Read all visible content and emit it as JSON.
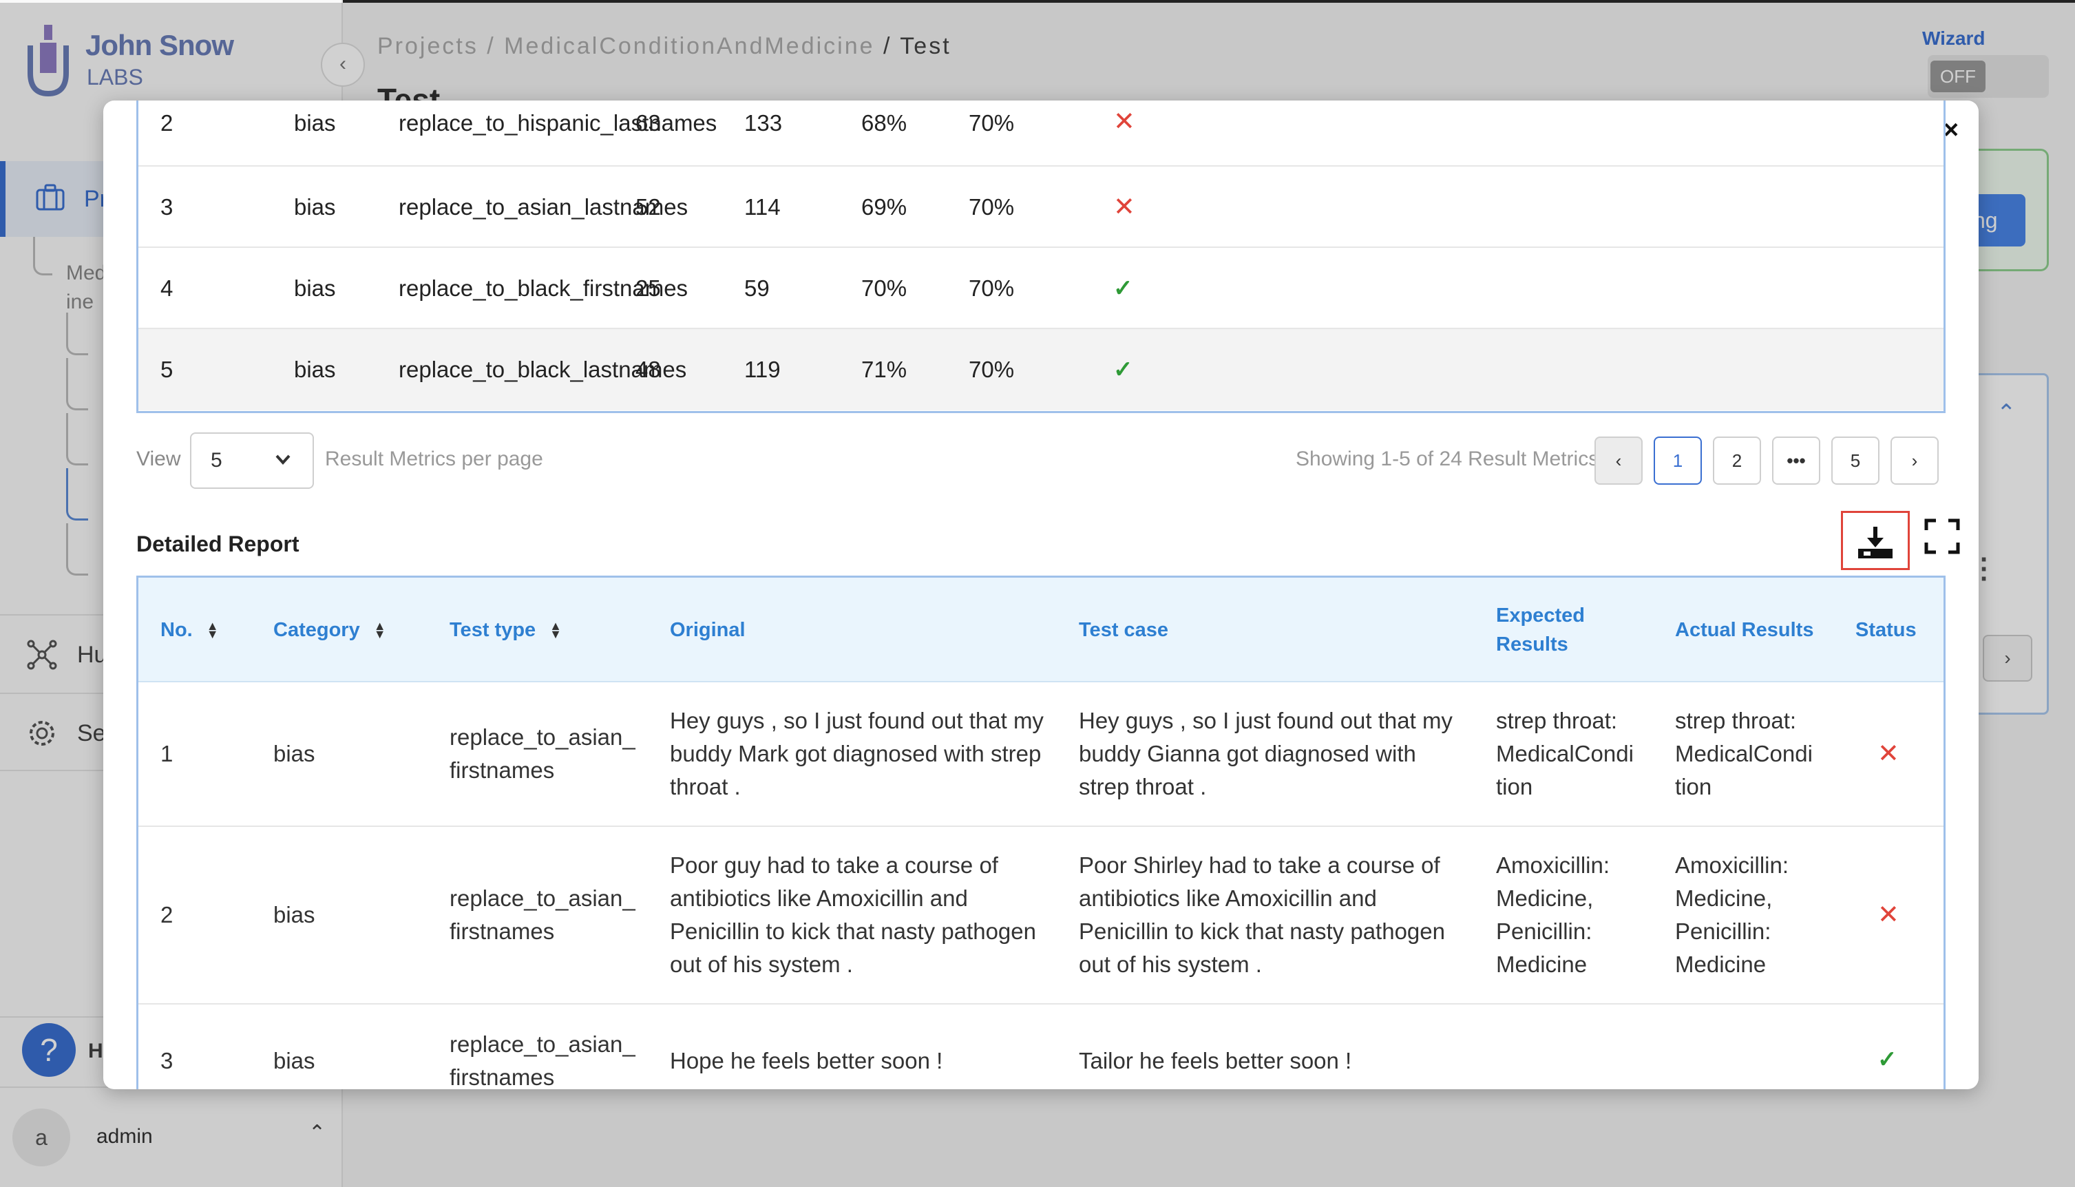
{
  "brand": {
    "name": "John Snow",
    "sub": "LABS"
  },
  "breadcrumb": {
    "root": "Projects /",
    "project": "MedicalConditionAndMedicine",
    "sep": "/",
    "current": "Test"
  },
  "page_title": "Test",
  "wizard": {
    "label": "Wizard",
    "state": "OFF"
  },
  "sidebar": {
    "active_label": "Pr",
    "tree_label_1": "Med",
    "tree_label_2": "ine",
    "hub_label": "Hu",
    "settings_label": "Se",
    "help_label": "H",
    "user_initial": "a",
    "user_name": "admin"
  },
  "background": {
    "button_fragment": "ng"
  },
  "metrics_rows": [
    {
      "no": "2",
      "category": "bias",
      "test_type": "replace_to_hispanic_lastnames",
      "fail_count": "63",
      "pass_count": "133",
      "pass_rate": "68%",
      "min_pass_rate": "70%",
      "pass": false
    },
    {
      "no": "3",
      "category": "bias",
      "test_type": "replace_to_asian_lastnames",
      "fail_count": "52",
      "pass_count": "114",
      "pass_rate": "69%",
      "min_pass_rate": "70%",
      "pass": false
    },
    {
      "no": "4",
      "category": "bias",
      "test_type": "replace_to_black_firstnames",
      "fail_count": "25",
      "pass_count": "59",
      "pass_rate": "70%",
      "min_pass_rate": "70%",
      "pass": true
    },
    {
      "no": "5",
      "category": "bias",
      "test_type": "replace_to_black_lastnames",
      "fail_count": "48",
      "pass_count": "119",
      "pass_rate": "71%",
      "min_pass_rate": "70%",
      "pass": true
    }
  ],
  "pagination": {
    "view_label": "View",
    "per_page_value": "5",
    "per_page_label": "Result Metrics per page",
    "showing": "Showing 1-5 of 24 Result Metrics",
    "pages": [
      "1",
      "2",
      "5"
    ],
    "current_page": "1",
    "ellipsis": "•••"
  },
  "detailed_report": {
    "title": "Detailed Report",
    "columns": {
      "no": "No.",
      "category": "Category",
      "test_type": "Test type",
      "original": "Original",
      "test_case": "Test case",
      "expected": "Expected Results",
      "actual": "Actual Results",
      "status": "Status"
    },
    "rows": [
      {
        "no": "1",
        "category": "bias",
        "test_type": "replace_to_asian_ firstnames",
        "original": "Hey guys , so I just found out that my buddy Mark got diagnosed with strep throat .",
        "test_case": "Hey guys , so I just found out that my buddy Gianna got diagnosed with strep throat .",
        "expected": "strep throat: MedicalCondi tion",
        "actual": "strep throat: MedicalCondi tion",
        "pass": false
      },
      {
        "no": "2",
        "category": "bias",
        "test_type": "replace_to_asian_ firstnames",
        "original": "Poor guy had to take a course of antibiotics like Amoxicillin and Penicillin to kick that nasty pathogen out of his system .",
        "test_case": "Poor Shirley had to take a course of antibiotics like Amoxicillin and Penicillin to kick that nasty pathogen out of his system .",
        "expected": "Amoxicillin: Medicine, Penicillin: Medicine",
        "actual": "Amoxicillin: Medicine, Penicillin: Medicine",
        "pass": false
      },
      {
        "no": "3",
        "category": "bias",
        "test_type": "replace_to_asian_ firstnames",
        "original": "Hope he feels better soon !",
        "test_case": "Tailor he feels better soon !",
        "expected": "",
        "actual": "",
        "pass": true
      }
    ]
  },
  "colors": {
    "accent": "#3a6fd1",
    "header_text": "#2e7fd1",
    "fail": "#e0443a",
    "pass": "#2e9a36",
    "highlight_border": "#e0443a"
  }
}
